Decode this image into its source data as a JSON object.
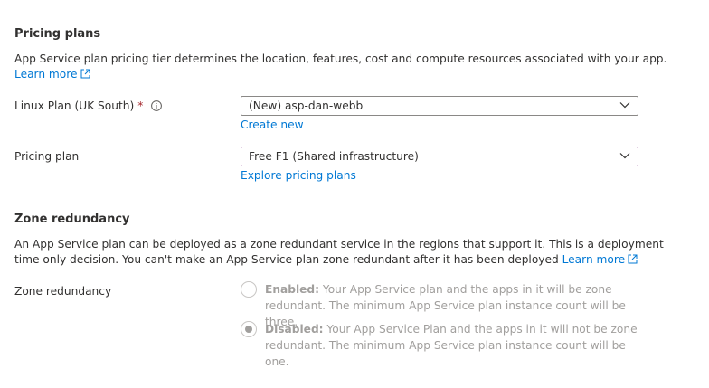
{
  "pricing": {
    "title": "Pricing plans",
    "description": "App Service plan pricing tier determines the location, features, cost and compute resources associated with your app.",
    "learn_more": "Learn more",
    "linux_plan_label": "Linux Plan (UK South)",
    "required_marker": "*",
    "linux_plan_value": "(New) asp-dan-webb",
    "create_new": "Create new",
    "pricing_plan_label": "Pricing plan",
    "pricing_plan_value": "Free F1 (Shared infrastructure)",
    "explore_plans": "Explore pricing plans"
  },
  "zone": {
    "title": "Zone redundancy",
    "description_line1": "An App Service plan can be deployed as a zone redundant service in the regions that support it. This is a deployment",
    "description_line2": "time only decision. You can't make an App Service plan zone redundant after it has been deployed",
    "learn_more": "Learn more",
    "label": "Zone redundancy",
    "enabled_title": "Enabled:",
    "enabled_text": " Your App Service plan and the apps in it will be zone redundant. The minimum App Service plan instance count will be three.",
    "disabled_title": "Disabled:",
    "disabled_text": " Your App Service Plan and the apps in it will not be zone redundant. The minimum App Service plan instance count will be one.",
    "selected": "disabled"
  },
  "colors": {
    "link": "#0078d4",
    "required": "#a4262c",
    "focus_border": "#8a3f8f",
    "disabled_text": "#a19f9d"
  }
}
